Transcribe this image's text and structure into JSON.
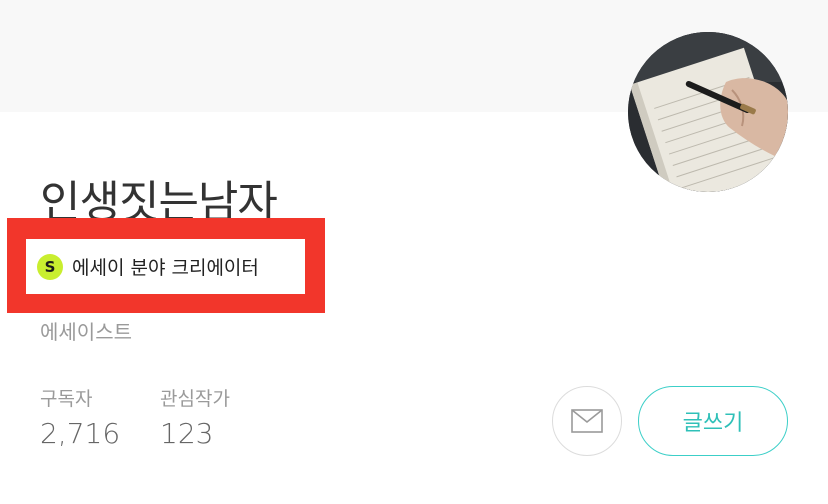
{
  "profile": {
    "name": "인생짓는남자",
    "badge": {
      "icon_letter": "S",
      "text": "에세이 분야 크리에이터"
    },
    "job": "에세이스트",
    "stats": {
      "subscribers_label": "구독자",
      "subscribers_value": "2,716",
      "following_label": "관심작가",
      "following_value": "123"
    },
    "avatar_icon": "writing-hand-photo"
  },
  "actions": {
    "mail_icon": "envelope-icon",
    "write_label": "글쓰기"
  },
  "colors": {
    "highlight": "#f2362b",
    "badge_mark": "#c9ee2f",
    "accent": "#3ccfc8",
    "cover": "#f8f8f8"
  }
}
